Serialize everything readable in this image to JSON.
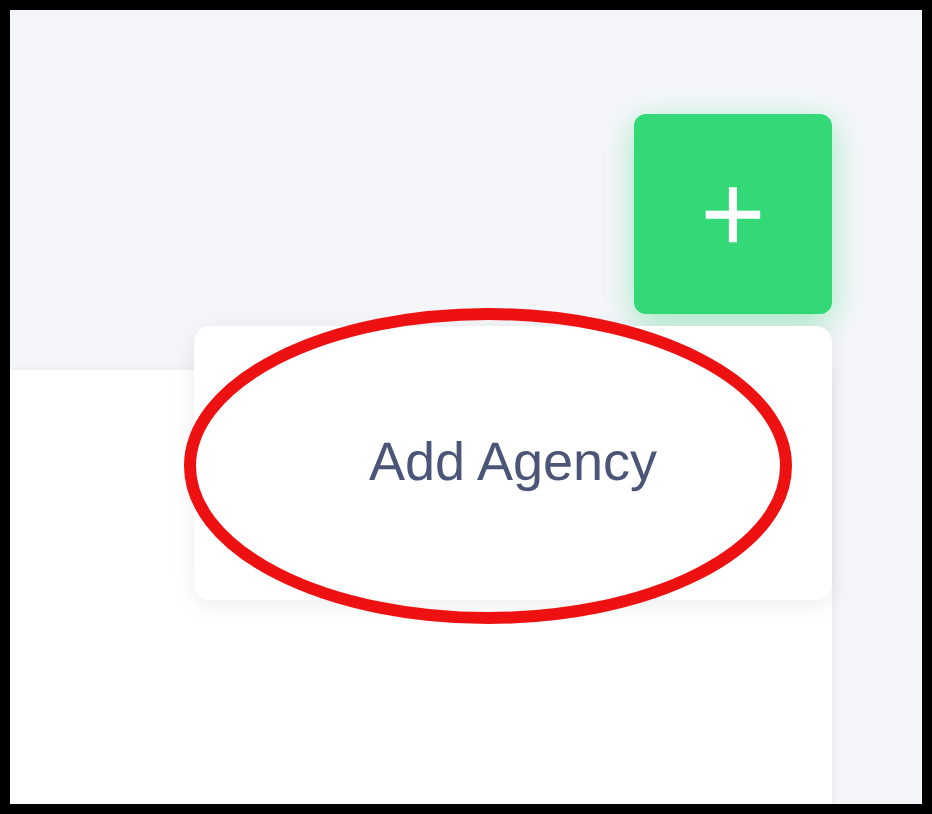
{
  "add_button": {
    "label": "+"
  },
  "menu": {
    "items": [
      {
        "label": "Add Agency",
        "highlighted": true
      }
    ]
  }
}
